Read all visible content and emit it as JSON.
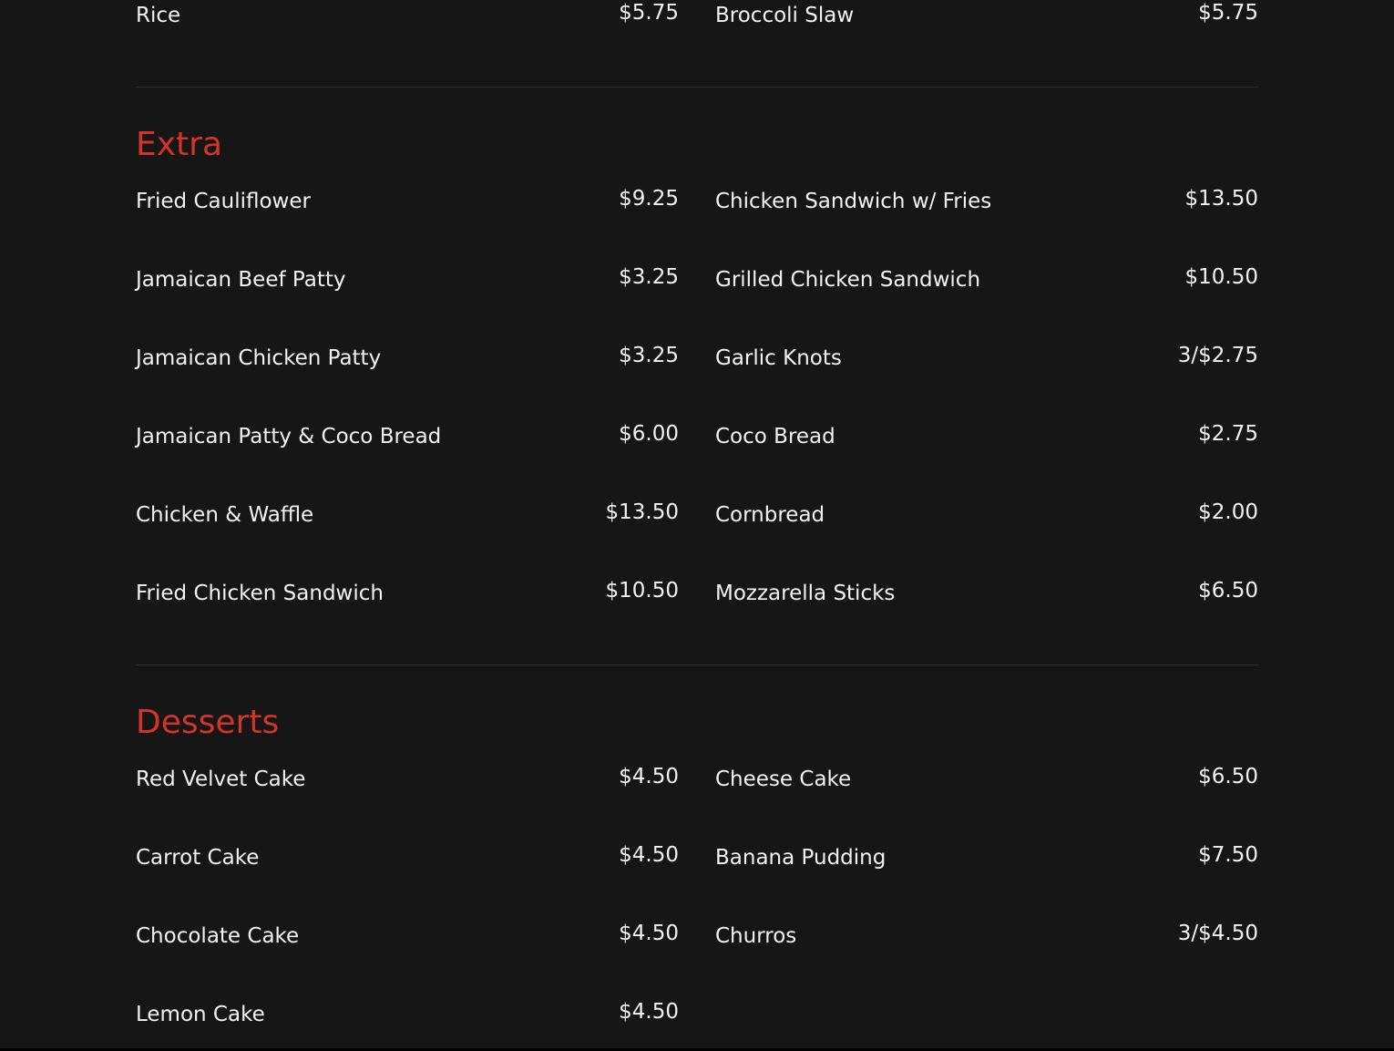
{
  "colors": {
    "background": "#161616",
    "heading": "#d2332b",
    "text": "#f2f2f2",
    "divider": "#2e2e2e"
  },
  "sections": [
    {
      "title": "",
      "left": [
        {
          "name": "Rice",
          "price": "$5.75"
        }
      ],
      "right": [
        {
          "name": "Broccoli Slaw",
          "price": "$5.75"
        }
      ]
    },
    {
      "title": "Extra",
      "left": [
        {
          "name": "Fried Cauliflower",
          "price": "$9.25"
        },
        {
          "name": "Jamaican Beef Patty",
          "price": "$3.25"
        },
        {
          "name": "Jamaican Chicken Patty",
          "price": "$3.25"
        },
        {
          "name": "Jamaican Patty & Coco Bread",
          "price": "$6.00"
        },
        {
          "name": "Chicken & Waffle",
          "price": "$13.50"
        },
        {
          "name": "Fried Chicken Sandwich",
          "price": "$10.50"
        }
      ],
      "right": [
        {
          "name": "Chicken Sandwich w/ Fries",
          "price": "$13.50"
        },
        {
          "name": "Grilled Chicken Sandwich",
          "price": "$10.50"
        },
        {
          "name": "Garlic Knots",
          "price": "3/$2.75"
        },
        {
          "name": "Coco Bread",
          "price": "$2.75"
        },
        {
          "name": "Cornbread",
          "price": "$2.00"
        },
        {
          "name": "Mozzarella Sticks",
          "price": "$6.50"
        }
      ]
    },
    {
      "title": "Desserts",
      "left": [
        {
          "name": "Red Velvet Cake",
          "price": "$4.50"
        },
        {
          "name": "Carrot Cake",
          "price": "$4.50"
        },
        {
          "name": "Chocolate Cake",
          "price": "$4.50"
        },
        {
          "name": "Lemon Cake",
          "price": "$4.50"
        }
      ],
      "right": [
        {
          "name": "Cheese Cake",
          "price": "$6.50"
        },
        {
          "name": "Banana Pudding",
          "price": "$7.50"
        },
        {
          "name": "Churros",
          "price": "3/$4.50"
        }
      ]
    }
  ]
}
